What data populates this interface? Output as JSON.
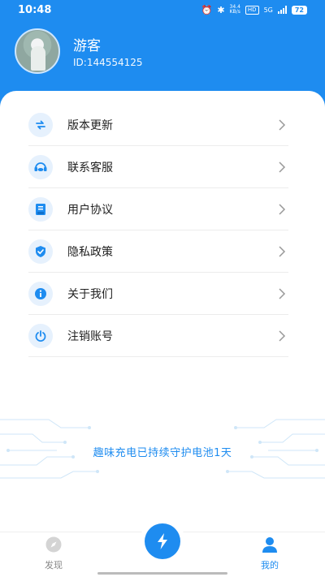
{
  "status_bar": {
    "time": "10:48",
    "net_speed_top": "34.4",
    "net_speed_bottom": "KB/s",
    "hd": "HD",
    "signal": "5G",
    "battery": "72"
  },
  "profile": {
    "name": "游客",
    "id": "ID:144554125"
  },
  "menu": {
    "items": [
      {
        "label": "版本更新",
        "icon": "refresh-icon"
      },
      {
        "label": "联系客服",
        "icon": "headset-icon"
      },
      {
        "label": "用户协议",
        "icon": "document-icon"
      },
      {
        "label": "隐私政策",
        "icon": "shield-icon"
      },
      {
        "label": "关于我们",
        "icon": "info-icon"
      },
      {
        "label": "注销账号",
        "icon": "power-icon"
      }
    ]
  },
  "slogan": "趣味充电已持续守护电池1天",
  "tabbar": {
    "tabs": [
      {
        "label": "发现",
        "icon": "compass-icon",
        "active": false
      },
      {
        "label": "",
        "icon": "lightning-icon",
        "active": false
      },
      {
        "label": "我的",
        "icon": "person-icon",
        "active": true
      }
    ]
  },
  "colors": {
    "accent": "#1e8cf0",
    "icon_bg": "#e6f1fd",
    "text": "#222222",
    "muted": "#888888"
  }
}
